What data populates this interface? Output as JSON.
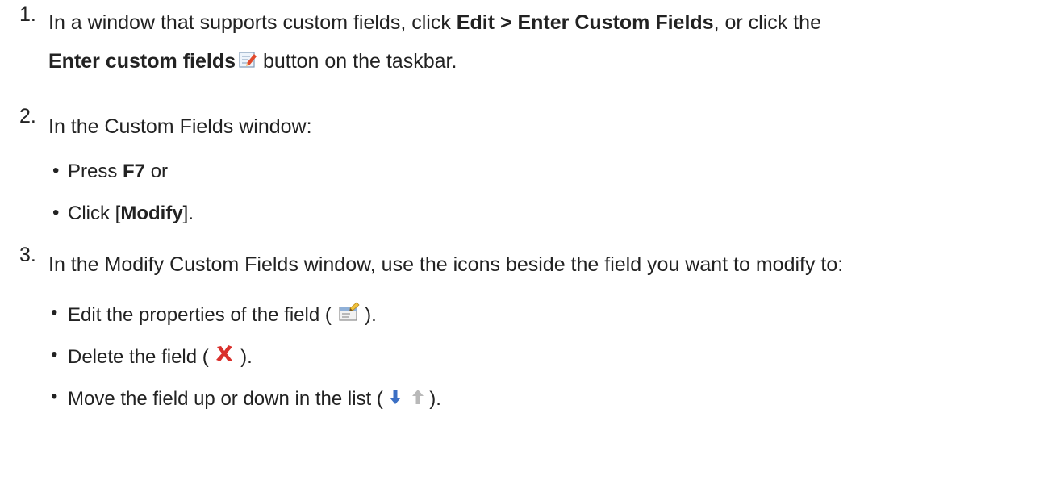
{
  "steps": [
    {
      "number": "1.",
      "line1": {
        "text_a": "In a window that supports custom fields, click ",
        "bold_a": "Edit > Enter Custom Fields",
        "text_b": ", or click the"
      },
      "line2": {
        "bold_a": "Enter custom fields",
        "icon": "edit-pencil-icon",
        "text_a": " button on the taskbar."
      }
    },
    {
      "number": "2.",
      "text": "In the Custom Fields window:",
      "bullets": [
        {
          "text_a": "Press ",
          "bold_a": "F7",
          "text_b": " or"
        },
        {
          "text_a": "Click [",
          "bold_a": "Modify",
          "text_b": "]."
        }
      ]
    },
    {
      "number": "3.",
      "text": "In the Modify Custom Fields window, use the icons beside the field you want to modify to:",
      "bullets": [
        {
          "text_a": "Edit the properties of the field ( ",
          "icon": "field-properties-icon",
          "text_b": " )."
        },
        {
          "text_a": "Delete the field ( ",
          "icon": "delete-x-icon",
          "text_b": " )."
        },
        {
          "text_a": "Move the field up or down in the list ( ",
          "icon_a": "arrow-down-icon",
          "icon_b": "arrow-up-icon",
          "text_b": " )."
        }
      ]
    }
  ],
  "colors": {
    "text": "#222222",
    "delete_red": "#d9302c",
    "arrow_blue": "#3b6fc4",
    "arrow_gray": "#b9b9b9"
  }
}
